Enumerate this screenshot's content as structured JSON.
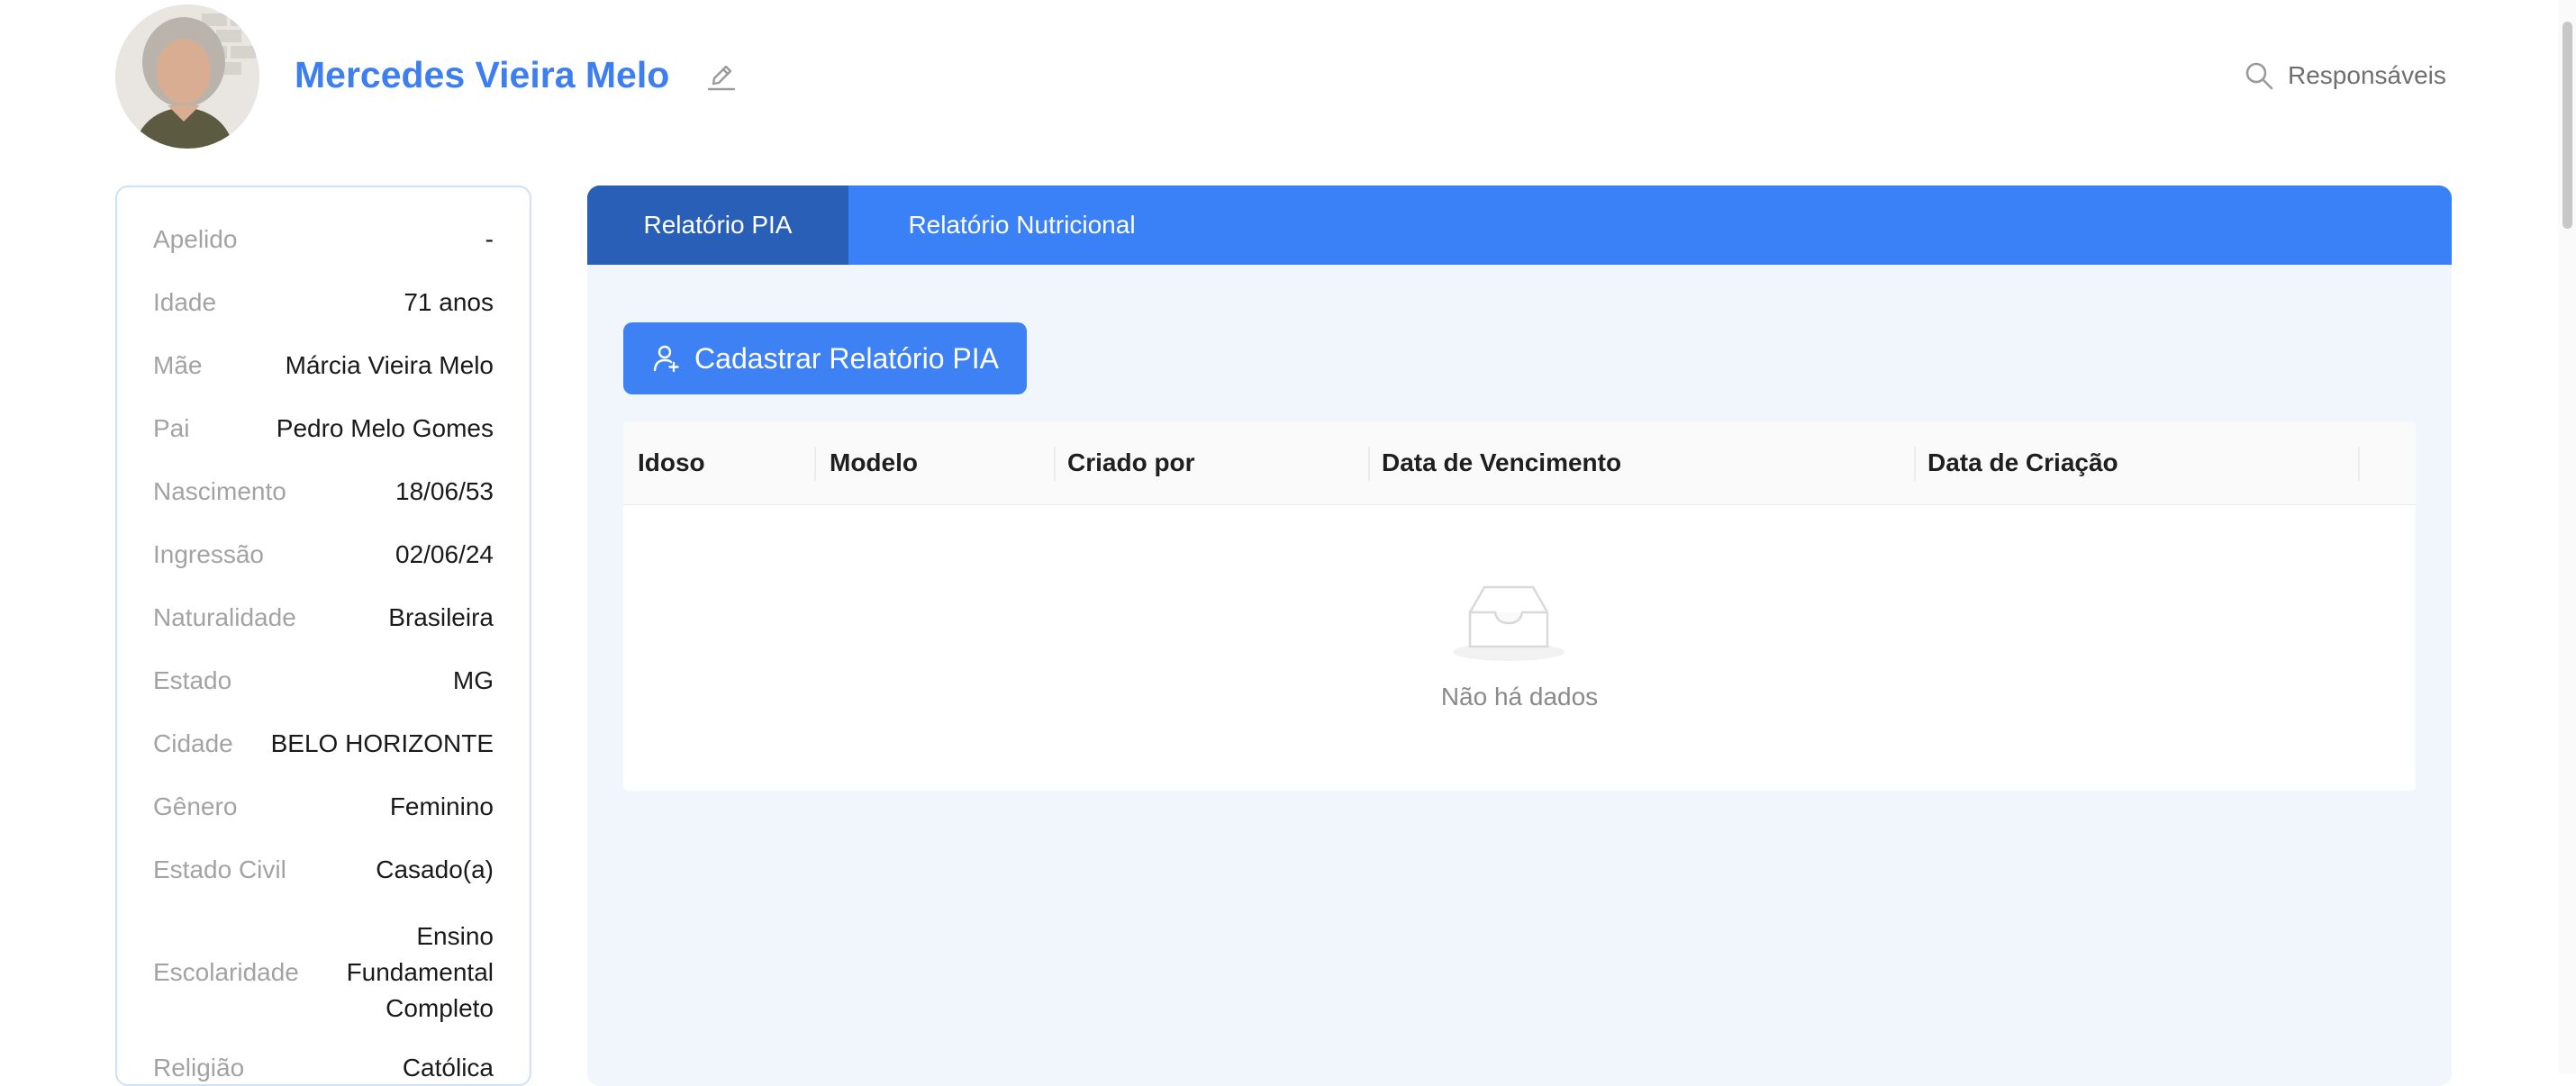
{
  "header": {
    "person_name": "Mercedes Vieira Melo",
    "responsaveis_label": "Responsáveis"
  },
  "profile": {
    "fields": [
      {
        "label": "Apelido",
        "value": "-"
      },
      {
        "label": "Idade",
        "value": "71 anos"
      },
      {
        "label": "Mãe",
        "value": "Márcia Vieira Melo"
      },
      {
        "label": "Pai",
        "value": "Pedro Melo Gomes"
      },
      {
        "label": "Nascimento",
        "value": "18/06/53"
      },
      {
        "label": "Ingressão",
        "value": "02/06/24"
      },
      {
        "label": "Naturalidade",
        "value": "Brasileira"
      },
      {
        "label": "Estado",
        "value": "MG"
      },
      {
        "label": "Cidade",
        "value": "BELO HORIZONTE"
      },
      {
        "label": "Gênero",
        "value": "Feminino"
      },
      {
        "label": "Estado Civil",
        "value": "Casado(a)"
      },
      {
        "label": "Escolaridade",
        "value_lines": [
          "Ensino",
          "Fundamental",
          "Completo"
        ]
      },
      {
        "label": "Religião",
        "value": "Católica"
      }
    ]
  },
  "tabs": [
    {
      "label": "Relatório PIA",
      "active": true
    },
    {
      "label": "Relatório Nutricional",
      "active": false
    }
  ],
  "actions": {
    "add_button_label": "Cadastrar Relatório PIA"
  },
  "table": {
    "columns": [
      "Idoso",
      "Modelo",
      "Criado por",
      "Data de Vencimento",
      "Data de Criação"
    ],
    "rows": [],
    "empty_text": "Não há dados"
  },
  "colors": {
    "accent": "#3d81f5",
    "tab_active": "#2a5fb8",
    "name": "#3d7ff0"
  },
  "icons": [
    "avatar-photo",
    "edit-icon",
    "search-icon",
    "user-add-icon",
    "inbox-empty-icon"
  ]
}
